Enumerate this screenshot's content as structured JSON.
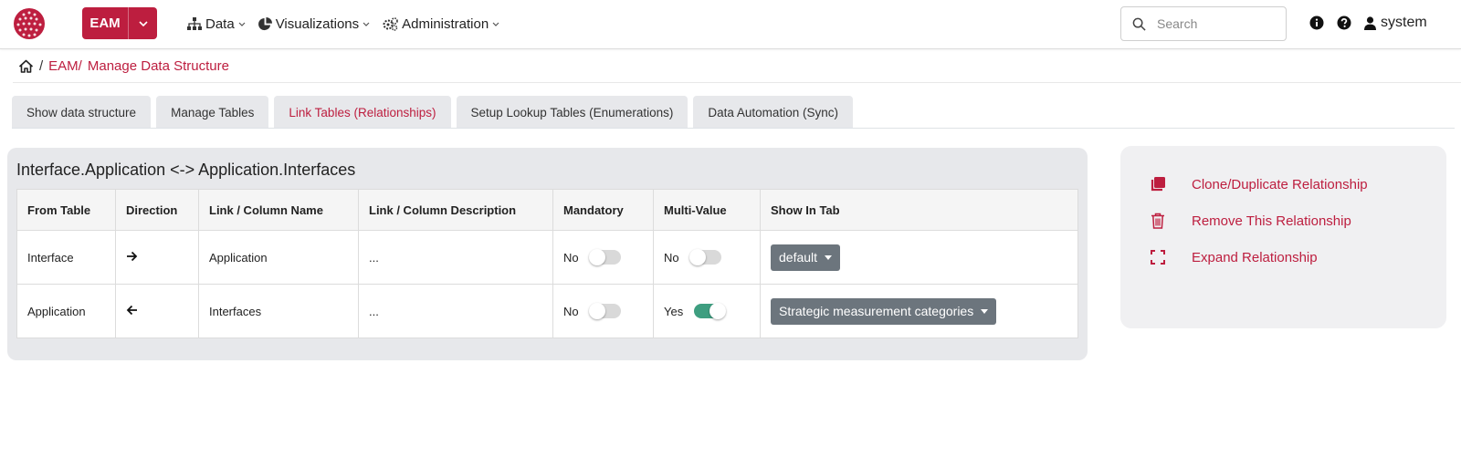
{
  "header": {
    "app_name": "EAM",
    "nav": [
      {
        "label": "Data"
      },
      {
        "label": "Visualizations"
      },
      {
        "label": "Administration"
      }
    ],
    "search": {
      "placeholder": "Search"
    },
    "user": "system"
  },
  "breadcrumb": {
    "sep": "/",
    "items": [
      "EAM/",
      "Manage Data Structure"
    ]
  },
  "tabs": [
    {
      "label": "Show data structure",
      "active": false
    },
    {
      "label": "Manage Tables",
      "active": false
    },
    {
      "label": "Link Tables (Relationships)",
      "active": true
    },
    {
      "label": "Setup Lookup Tables (Enumerations)",
      "active": false
    },
    {
      "label": "Data Automation (Sync)",
      "active": false
    }
  ],
  "relationship": {
    "title": "Interface.Application <-> Application.Interfaces",
    "columns": [
      "From Table",
      "Direction",
      "Link / Column Name",
      "Link / Column Description",
      "Mandatory",
      "Multi-Value",
      "Show In Tab"
    ],
    "rows": [
      {
        "from": "Interface",
        "direction": "right-arrow-icon",
        "name": "Application",
        "description": "...",
        "mandatory": "No",
        "mandatory_on": false,
        "multi": "No",
        "multi_on": false,
        "tab": "default"
      },
      {
        "from": "Application",
        "direction": "left-arrow-icon",
        "name": "Interfaces",
        "description": "...",
        "mandatory": "No",
        "mandatory_on": false,
        "multi": "Yes",
        "multi_on": true,
        "tab": "Strategic measurement categories"
      }
    ]
  },
  "actions": [
    {
      "label": "Clone/Duplicate Relationship",
      "icon": "clone-icon"
    },
    {
      "label": "Remove This Relationship",
      "icon": "trash-icon"
    },
    {
      "label": "Expand Relationship",
      "icon": "expand-icon"
    }
  ],
  "colors": {
    "brand": "#bd1e3f",
    "toggle_on": "#3e9e80",
    "dropdown": "#6c757d"
  }
}
